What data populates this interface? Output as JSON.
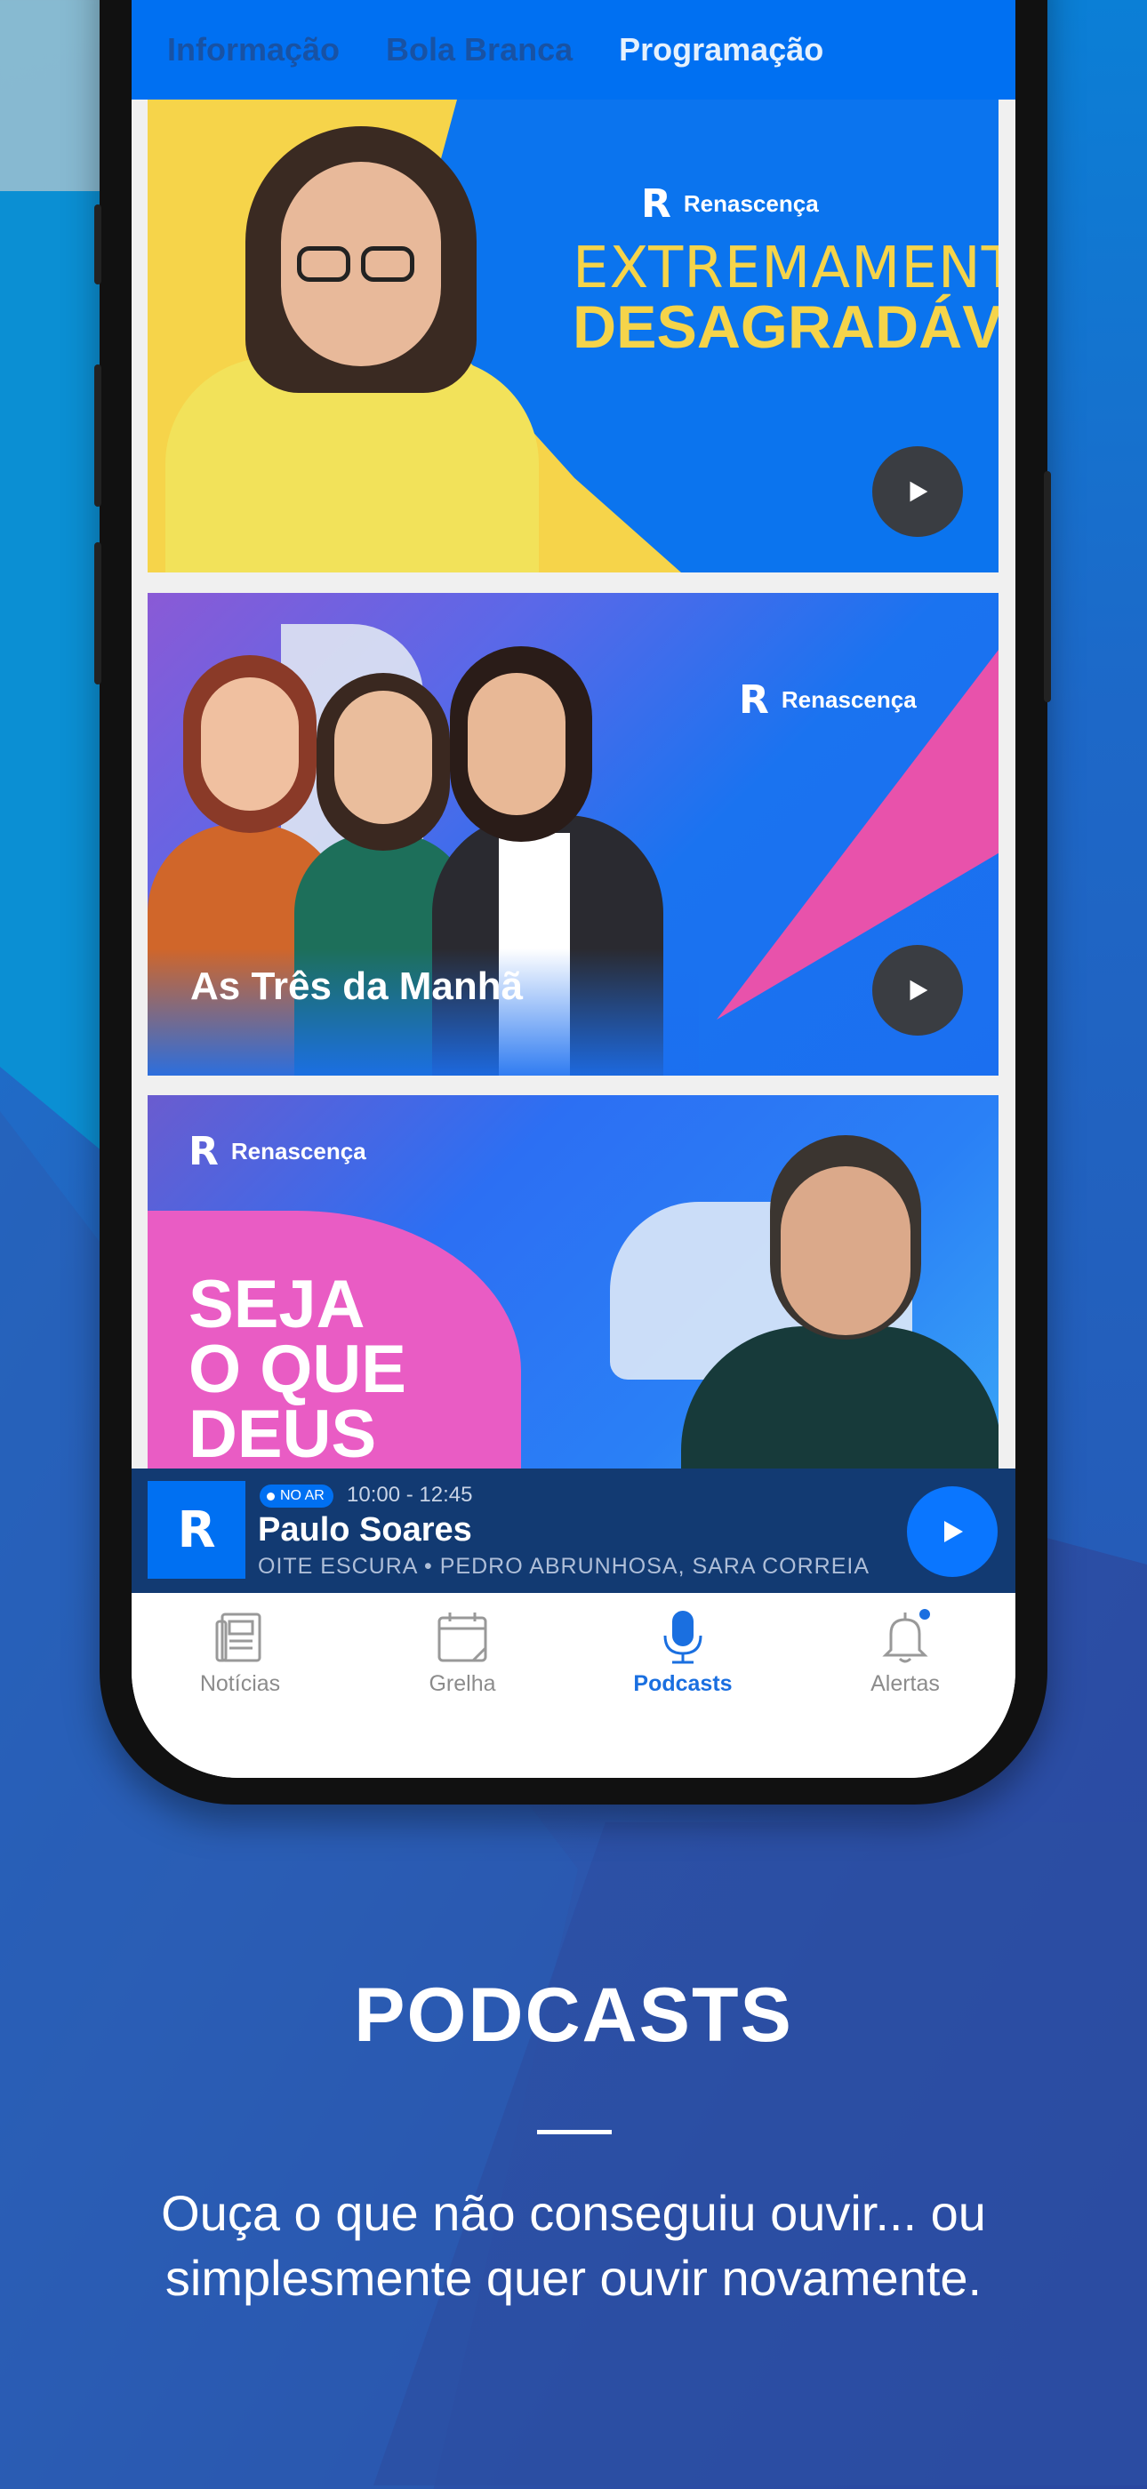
{
  "top_tabs": [
    {
      "label": "Informação"
    },
    {
      "label": "Bola Branca"
    },
    {
      "label": "Programação"
    }
  ],
  "brand": {
    "name": "Renascença",
    "accent": "#0070f2",
    "yellow": "#f6d44a",
    "pink": "#ff4fa3"
  },
  "cards": [
    {
      "title_line1": "EXTREMAMENTE",
      "title_line2": "DESAGRADÁVEL",
      "logo": "Renascença"
    },
    {
      "title": "As Três da Manhã",
      "logo": "Renascença"
    },
    {
      "title_lines": [
        "SEJA",
        "O QUE",
        "DEUS"
      ],
      "logo": "Renascença"
    }
  ],
  "now_playing": {
    "badge": "NO AR",
    "time": "10:00 - 12:45",
    "show": "Paulo Soares",
    "ticker": "OITE ESCURA • PEDRO ABRUNHOSA, SARA CORREIA"
  },
  "tab_bar": [
    {
      "label": "Notícias",
      "icon": "newspaper-icon"
    },
    {
      "label": "Grelha",
      "icon": "calendar-icon"
    },
    {
      "label": "Podcasts",
      "icon": "microphone-icon",
      "active": true
    },
    {
      "label": "Alertas",
      "icon": "bell-icon",
      "notification": true
    }
  ],
  "marketing": {
    "heading": "PODCASTS",
    "subtitle": "Ouça o que não conseguiu ouvir... ou simplesmente quer ouvir novamente."
  }
}
